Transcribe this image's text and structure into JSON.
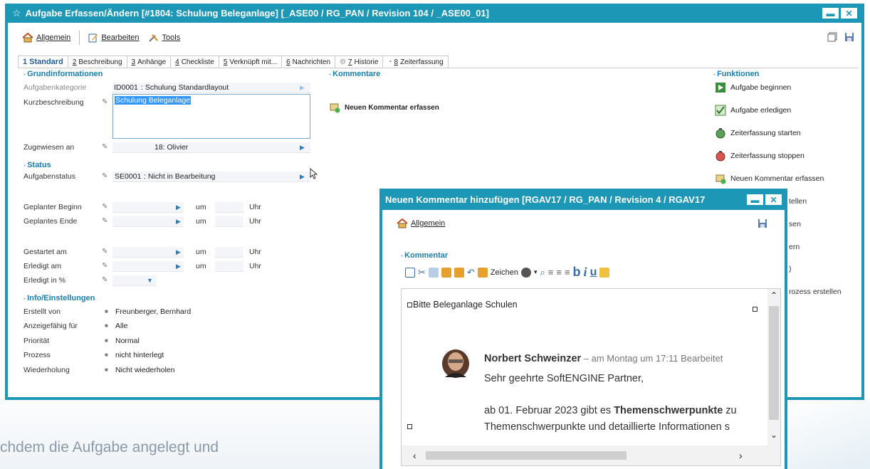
{
  "main_window": {
    "title": "Aufgabe Erfassen/Ändern [#1804: Schulung Beleganlage] [_ASE00 / RG_PAN / Revision 104 / _ASE00_01]",
    "minimize": "▬",
    "close": "✕",
    "toolbar": {
      "allgemein": "Allgemein",
      "bearbeiten": "Bearbeiten",
      "tools": "Tools"
    },
    "tabs": [
      {
        "num": "1",
        "label": "Standard"
      },
      {
        "num": "2",
        "label": "Beschreibung"
      },
      {
        "num": "3",
        "label": "Anhänge"
      },
      {
        "num": "4",
        "label": "Checkliste"
      },
      {
        "num": "5",
        "label": "Verknüpft mit..."
      },
      {
        "num": "6",
        "label": "Nachrichten"
      },
      {
        "num": "7",
        "label": "Historie"
      },
      {
        "num": "8",
        "label": "Zeiterfassung"
      }
    ],
    "sections": {
      "grundinfo": "Grundinformationen",
      "status": "Status",
      "info": "Info/Einstellungen",
      "kommentare": "Kommentare",
      "funktionen": "Funktionen"
    },
    "fields": {
      "aufgabenkategorie_label": "Aufgabenkategorie",
      "aufgabenkategorie_code": "ID0001",
      "aufgabenkategorie_value": ": Schulung Standardlayout",
      "kurzbeschreibung_label": "Kurzbeschreibung",
      "kurzbeschreibung_value": "Schulung Beleganlage",
      "zugewiesen_label": "Zugewiesen an",
      "zugewiesen_value": "18: Olivier",
      "aufgabenstatus_label": "Aufgabenstatus",
      "aufgabenstatus_code": "SE0001",
      "aufgabenstatus_value": ": Nicht in Bearbeitung",
      "geplanter_beginn_label": "Geplanter Beginn",
      "geplantes_ende_label": "Geplantes Ende",
      "gestartet_label": "Gestartet am",
      "erledigt_label": "Erledigt am",
      "erledigt_pct_label": "Erledigt in %",
      "um": "um",
      "uhr": "Uhr",
      "erstellt_label": "Erstellt von",
      "erstellt_value": "Freunberger, Bernhard",
      "anzeige_label": "Anzeigefähig für",
      "anzeige_value": "Alle",
      "prioritaet_label": "Priorität",
      "prioritaet_value": "Normal",
      "prozess_label": "Prozess",
      "prozess_value": "nicht hinterlegt",
      "wiederholung_label": "Wiederholung",
      "wiederholung_value": "Nicht wiederholen"
    },
    "kommentar_action": "Neuen Kommentar erfassen",
    "funktionen": [
      "Aufgabe beginnen",
      "Aufgabe erledigen",
      "Zeiterfassung starten",
      "Zeiterfassung stoppen",
      "Neuen Kommentar erfassen"
    ],
    "partial_funktionen": [
      "tellen",
      "sen",
      "ern",
      "rozess erstellen"
    ]
  },
  "dialog": {
    "title": "Neuen Kommentar hinzufügen [RGAV17 / RG_PAN / Revision 4 / RGAV17",
    "allgemein": "Allgemein",
    "section": "Kommentar",
    "zeichen": "Zeichen",
    "editor_text": "Bitte Beleganlage Schulen",
    "author": "Norbert Schweinzer",
    "meta": " – am Montag um 17:11   Bearbeitet",
    "greeting": "Sehr geehrte SoftENGINE Partner,",
    "body_line1_pre": "ab 01. Februar 2023 gibt es ",
    "body_line1_bold": "Themenschwerpunkte",
    "body_line1_post": " zu",
    "body_line2": "Themenschwerpunkte und detaillierte Informationen s"
  },
  "caption": "chdem die Aufgabe angelegt und",
  "colors": {
    "accent": "#1c97b6",
    "section": "#1a7fb0"
  }
}
